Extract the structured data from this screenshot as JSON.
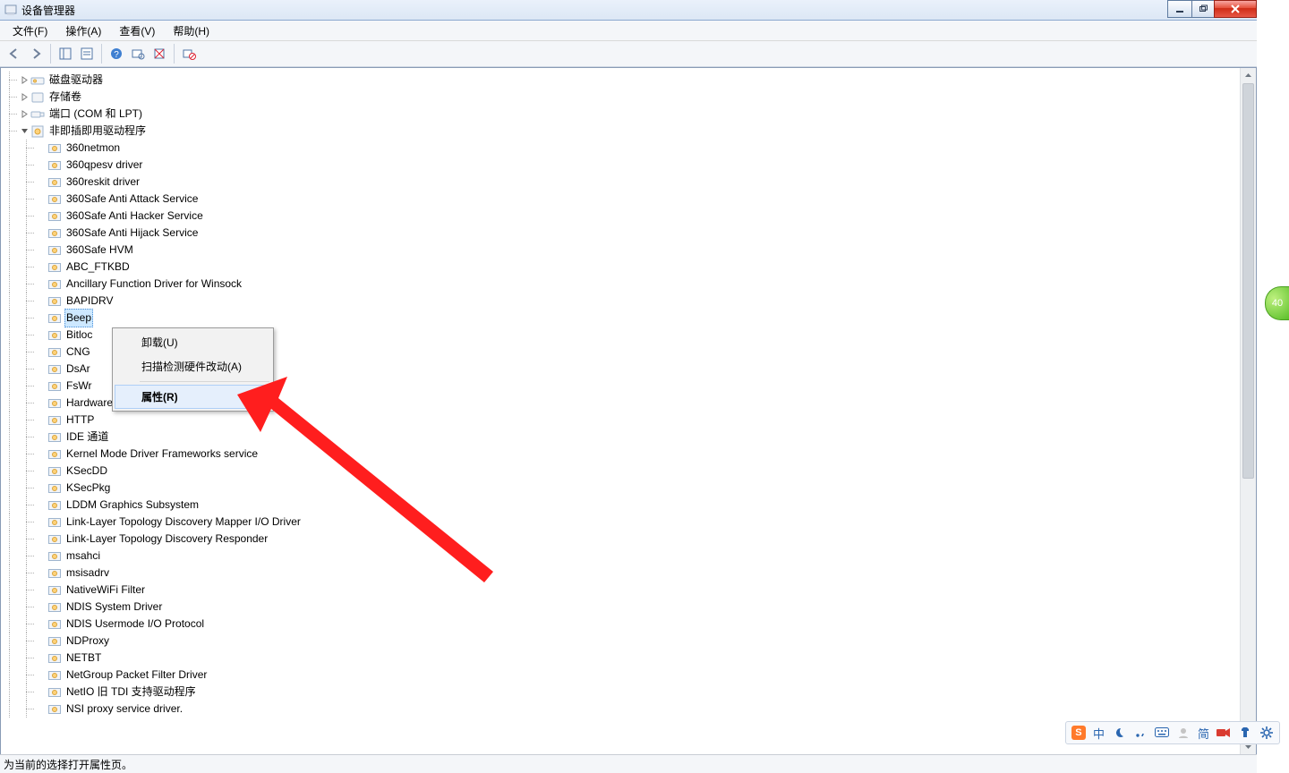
{
  "window": {
    "title": "设备管理器"
  },
  "menu": {
    "file": "文件(F)",
    "action": "操作(A)",
    "view": "查看(V)",
    "help": "帮助(H)"
  },
  "tree": {
    "top_nodes": [
      {
        "label": "磁盘驱动器",
        "icon": "disk",
        "expand": "collapsed"
      },
      {
        "label": "存储卷",
        "icon": "volume",
        "expand": "collapsed"
      },
      {
        "label": "端口 (COM 和 LPT)",
        "icon": "port",
        "expand": "collapsed"
      }
    ],
    "nonpnp": {
      "label": "非即插即用驱动程序",
      "children": [
        "360netmon",
        "360qpesv driver",
        "360reskit driver",
        "360Safe Anti Attack Service",
        "360Safe Anti Hacker Service",
        "360Safe Anti Hijack Service",
        "360Safe HVM",
        "ABC_FTKBD",
        "Ancillary Function Driver for Winsock",
        "BAPIDRV",
        "Beep",
        "Bitloc",
        "CNG",
        "DsAr",
        "FsWr",
        "Hardware Policy Driver",
        "HTTP",
        "IDE 通道",
        "Kernel Mode Driver Frameworks service",
        "KSecDD",
        "KSecPkg",
        "LDDM Graphics Subsystem",
        "Link-Layer Topology Discovery Mapper I/O Driver",
        "Link-Layer Topology Discovery Responder",
        "msahci",
        "msisadrv",
        "NativeWiFi Filter",
        "NDIS System Driver",
        "NDIS Usermode I/O Protocol",
        "NDProxy",
        "NETBT",
        "NetGroup Packet Filter Driver",
        "NetIO 旧 TDI 支持驱动程序",
        "NSI proxy service driver."
      ],
      "selected_index": 10,
      "truncated_after_menu": [
        11,
        12,
        13,
        14
      ]
    }
  },
  "context_menu": {
    "uninstall": "卸载(U)",
    "scan": "扫描检测硬件改动(A)",
    "properties": "属性(R)"
  },
  "status": {
    "text": "为当前的选择打开属性页。"
  },
  "tray": {
    "zhong": "中",
    "jian": "简"
  },
  "edge_badge": {
    "text": "40"
  }
}
